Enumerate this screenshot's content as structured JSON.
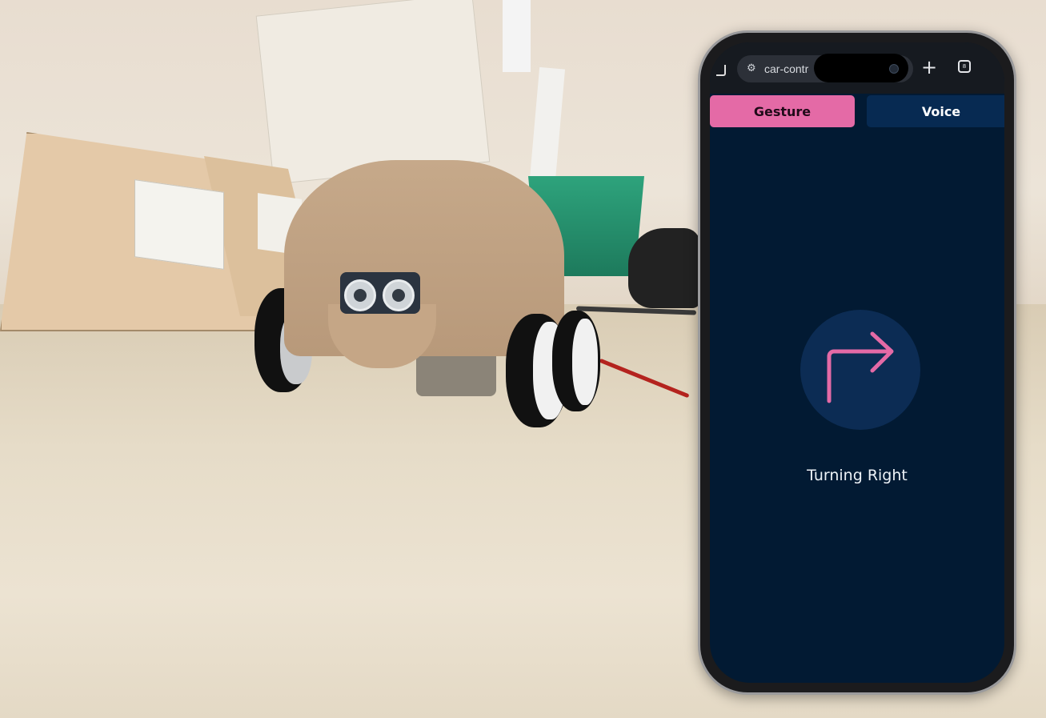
{
  "browser": {
    "url_text": "car-contro",
    "tab_count": "8"
  },
  "tabs": [
    {
      "label": "Gesture",
      "active": true
    },
    {
      "label": "Voice",
      "active": false
    }
  ],
  "main": {
    "direction_icon": "arrow-turn-right-icon",
    "status_text": "Turning Right"
  },
  "colors": {
    "screen_bg": "#021a33",
    "active_tab": "#e46aa6",
    "inactive_tab": "#072a52",
    "arrow": "#e46aa6"
  }
}
